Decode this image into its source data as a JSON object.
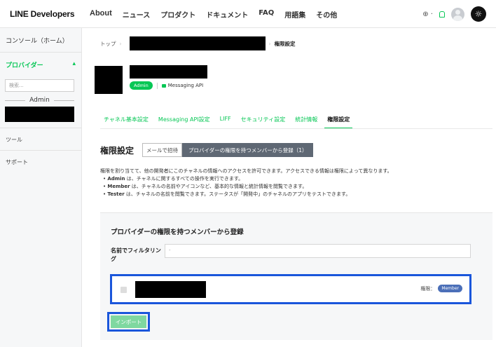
{
  "header": {
    "logo": "LINE Developers",
    "nav": [
      "About",
      "ニュース",
      "プロダクト",
      "ドキュメント",
      "FAQ",
      "用語集",
      "その他"
    ],
    "lang": "⊕ ·"
  },
  "sidebar": {
    "console_home": "コンソール（ホーム）",
    "provider": "プロバイダー",
    "provider_chevron": "▴",
    "search_placeholder": "検索...",
    "admin_label": "Admin",
    "tools": "ツール",
    "support": "サポート"
  },
  "breadcrumb": {
    "top": "トップ",
    "current": "権限設定"
  },
  "channel": {
    "role_badge": "Admin",
    "type": "Messaging API"
  },
  "tabs": [
    "チャネル基本設定",
    "Messaging API設定",
    "LIFF",
    "セキュリティ設定",
    "統計情報",
    "権限設定"
  ],
  "section": {
    "title": "権限設定",
    "invite_btn": "メールで招待",
    "register_btn": "プロバイダーの権限を持つメンバーから登録（1）"
  },
  "description": {
    "intro": "権限を割り当てて、他の開発者にこのチャネルの情報へのアクセスを許可できます。アクセスできる情報は権限によって異なります。",
    "items": [
      {
        "role": "Admin",
        "text": " は、チャネルに関するすべての操作を実行できます。"
      },
      {
        "role": "Member",
        "text": " は、チャネルの名前やアイコンなど、基本的な情報と統計情報を閲覧できます。"
      },
      {
        "role": "Tester",
        "text": " は、チャネルの名前を閲覧できます。ステータスが「開発中」のチャネルのアプリをテストできます。"
      }
    ]
  },
  "panel": {
    "title": "プロバイダーの権限を持つメンバーから登録",
    "filter_label": "名前でフィルタリング",
    "filter_placeholder": "-",
    "perm_label": "権限：",
    "perm_value": "Member",
    "import_btn": "インポート"
  }
}
